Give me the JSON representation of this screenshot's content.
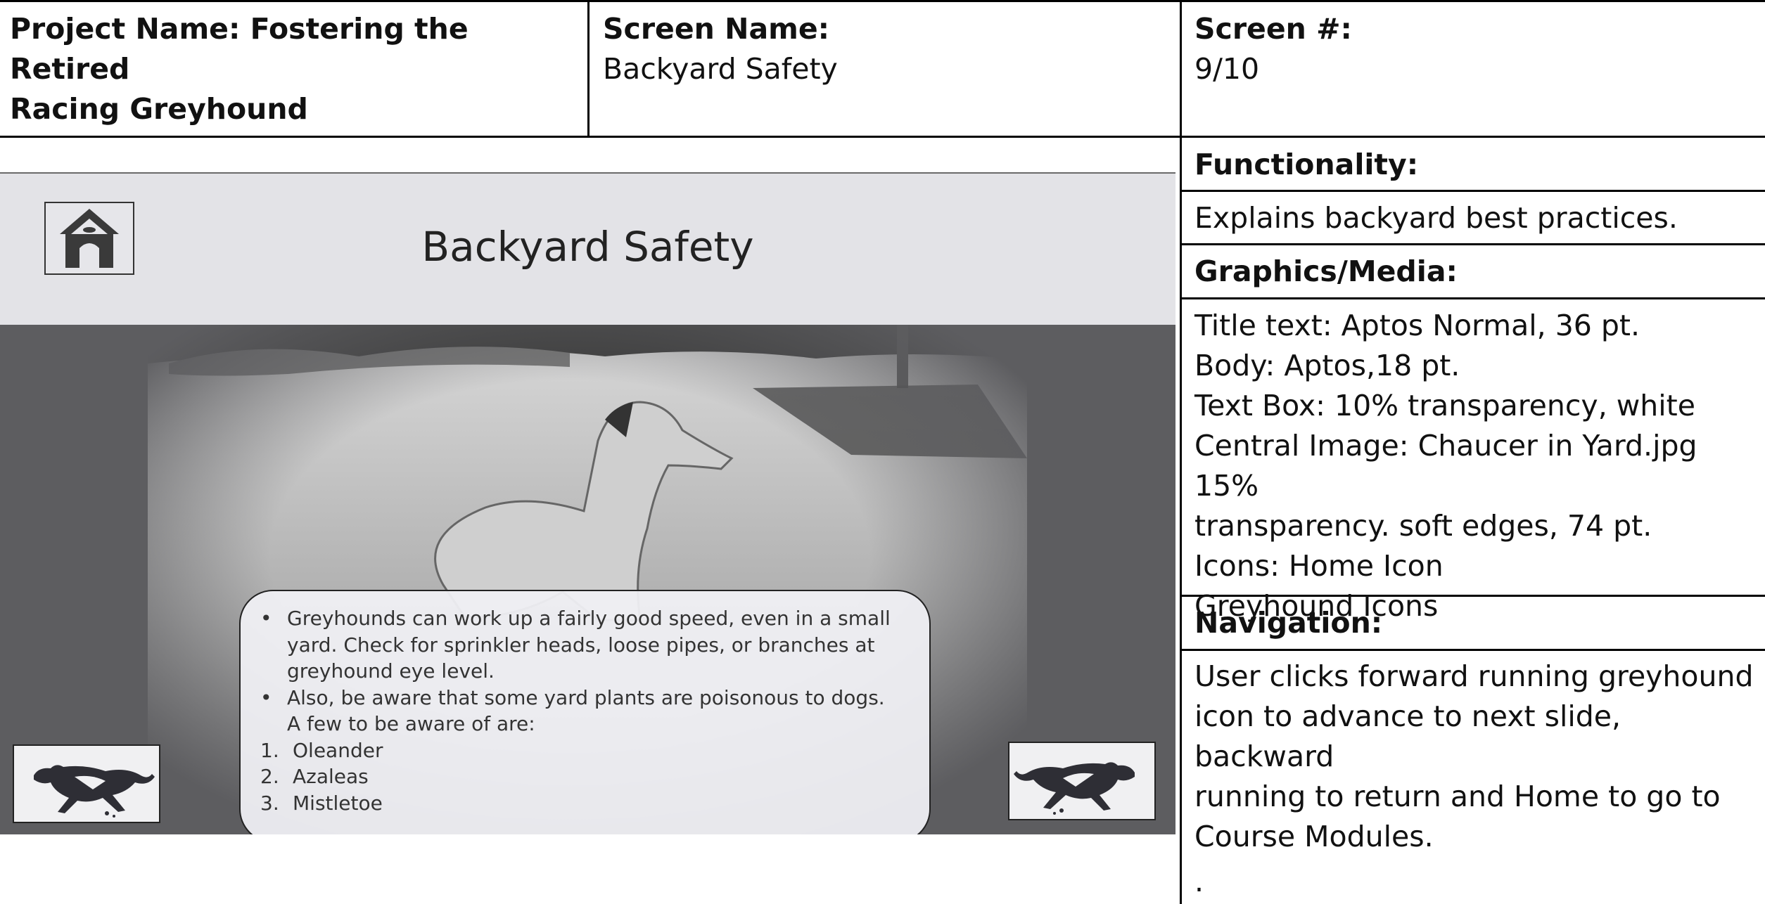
{
  "header": {
    "project_label": "Project Name: Fostering the Retired",
    "project_label_2": "Racing Greyhound",
    "screen_name_label": "Screen Name:",
    "screen_name_value": "Backyard Safety",
    "screen_num_label": "Screen #:",
    "screen_num_value": "9/10"
  },
  "slide": {
    "title": "Backyard Safety",
    "bullets": [
      "Greyhounds can work up a fairly good speed, even in a  small yard. Check for sprinkler heads, loose pipes, or branches at greyhound eye level.",
      "Also, be aware that some yard plants are poisonous to dogs. A few to be aware of are:"
    ],
    "bullet_mark": "•",
    "plants": [
      {
        "num": "1.",
        "name": "Oleander"
      },
      {
        "num": "2.",
        "name": "Azaleas"
      },
      {
        "num": "3.",
        "name": "Mistletoe"
      }
    ],
    "icons": {
      "home": "dog-house-icon",
      "back": "running-greyhound-icon",
      "forward": "running-greyhound-icon"
    }
  },
  "side": {
    "functionality_label": "Functionality:",
    "functionality_text": "Explains backyard best practices.",
    "graphics_label": "Graphics/Media:",
    "graphics_lines": [
      "Title text: Aptos Normal, 36 pt.",
      "Body: Aptos,18 pt.",
      "Text Box: 10% transparency, white",
      "Central Image: Chaucer in Yard.jpg 15%",
      "transparency. soft edges, 74 pt.",
      "Icons: Home Icon",
      "Greyhound Icons"
    ],
    "navigation_label": "Navigation:",
    "navigation_lines": [
      "User clicks forward running greyhound",
      "icon to advance to next slide, backward",
      "running to return and Home to go to",
      "Course Modules."
    ],
    "trailing_mark": "."
  }
}
